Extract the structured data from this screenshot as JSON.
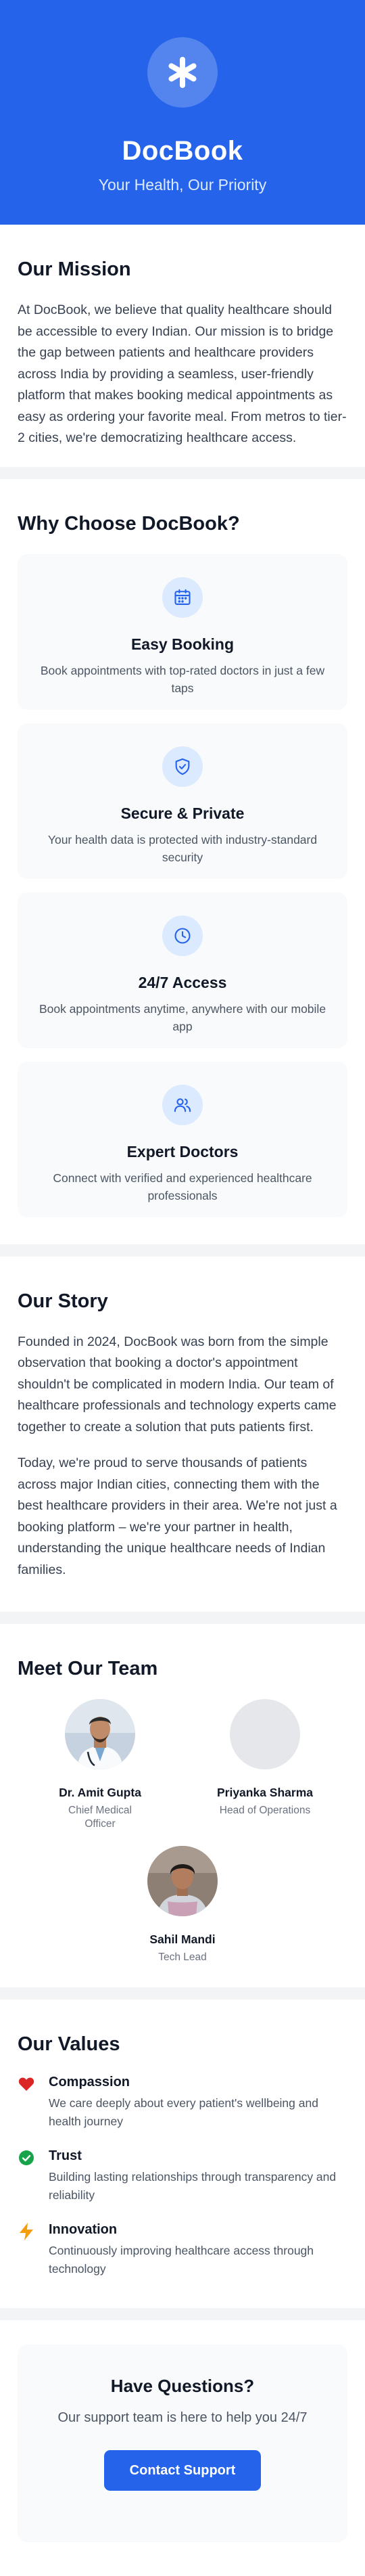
{
  "hero": {
    "title": "DocBook",
    "subtitle": "Your Health, Our Priority",
    "logo_icon": "asterisk-icon",
    "bg_color": "#2563eb"
  },
  "mission": {
    "heading": "Our Mission",
    "text": "At DocBook, we believe that quality healthcare should be accessible to every Indian. Our mission is to bridge the gap between patients and healthcare providers across India by providing a seamless, user-friendly platform that makes booking medical appointments as easy as ordering your favorite meal. From metros to tier-2 cities, we're democratizing healthcare access."
  },
  "why": {
    "heading": "Why Choose DocBook?",
    "features": [
      {
        "icon": "calendar-icon",
        "title": "Easy Booking",
        "desc": "Book appointments with top-rated doctors in just a few taps"
      },
      {
        "icon": "shield-check-icon",
        "title": "Secure & Private",
        "desc": "Your health data is protected with industry-standard security"
      },
      {
        "icon": "clock-icon",
        "title": "24/7 Access",
        "desc": "Book appointments anytime, anywhere with our mobile app"
      },
      {
        "icon": "users-icon",
        "title": "Expert Doctors",
        "desc": "Connect with verified and experienced healthcare professionals"
      }
    ]
  },
  "story": {
    "heading": "Our Story",
    "paragraphs": [
      "Founded in 2024, DocBook was born from the simple observation that booking a doctor's appointment shouldn't be complicated in modern India. Our team of healthcare professionals and technology experts came together to create a solution that puts patients first.",
      "Today, we're proud to serve thousands of patients across major Indian cities, connecting them with the best healthcare providers in their area. We're not just a booking platform – we're your partner in health, understanding the unique healthcare needs of Indian families."
    ]
  },
  "team": {
    "heading": "Meet Our Team",
    "members": [
      {
        "name": "Dr. Amit Gupta",
        "role": "Chief Medical Officer"
      },
      {
        "name": "Priyanka Sharma",
        "role": "Head of Operations"
      },
      {
        "name": "Sahil Mandi",
        "role": "Tech Lead"
      }
    ]
  },
  "values": {
    "heading": "Our Values",
    "items": [
      {
        "icon": "heart-icon",
        "color": "#dc2626",
        "title": "Compassion",
        "desc": "We care deeply about every patient's wellbeing and health journey"
      },
      {
        "icon": "check-circle-icon",
        "color": "#16a34a",
        "title": "Trust",
        "desc": "Building lasting relationships through transparency and reliability"
      },
      {
        "icon": "lightning-icon",
        "color": "#f59e0b",
        "title": "Innovation",
        "desc": "Continuously improving healthcare access through technology"
      }
    ]
  },
  "cta": {
    "title": "Have Questions?",
    "subtitle": "Our support team is here to help you 24/7",
    "button_label": "Contact Support"
  }
}
